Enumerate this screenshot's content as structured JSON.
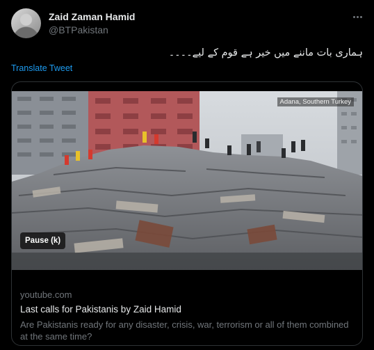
{
  "author": {
    "name": "Zaid Zaman Hamid",
    "handle": "@BTPakistan"
  },
  "tweet": {
    "text": "ہماری بات ماننے میں خیر ہے قوم کے لیے۔۔۔۔",
    "translate_label": "Translate Tweet"
  },
  "card": {
    "video_overlay_location": "Adana, Southern Turkey",
    "pause_label": "Pause (k)",
    "domain": "youtube.com",
    "title": "Last calls for Pakistanis by Zaid Hamid",
    "description": "Are Pakistanis ready for any disaster, crisis, war, terrorism or all of them combined at the same time?"
  },
  "icons": {
    "more": "more-options-icon"
  },
  "colors": {
    "background": "#000000",
    "primary_text": "#e7e9ea",
    "secondary_text": "#71767b",
    "link": "#1d9bf0",
    "border": "#2f3336"
  }
}
